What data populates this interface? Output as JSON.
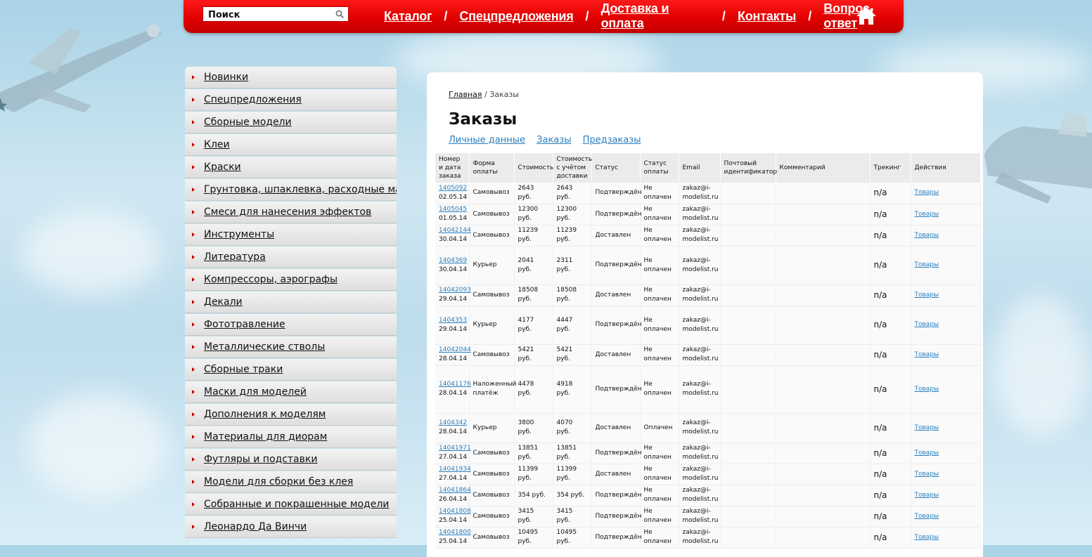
{
  "search": {
    "placeholder": "Поиск"
  },
  "topnav": {
    "items": [
      "Каталог",
      "Спецпредложения",
      "Доставка и оплата",
      "Контакты",
      "Вопрос-ответ"
    ],
    "separator": "/"
  },
  "sidebar": {
    "items": [
      "Новинки",
      "Спецпредложения",
      "Сборные модели",
      "Клеи",
      "Краски",
      "Грунтовка, шпаклевка, расходные материалы",
      "Смеси для нанесения эффектов",
      "Инструменты",
      "Литература",
      "Компрессоры, аэрографы",
      "Декали",
      "Фототравление",
      "Металлические стволы",
      "Сборные траки",
      "Маски для моделей",
      "Дополнения к моделям",
      "Материалы для диорам",
      "Футляры и подставки",
      "Модели для сборки без клея",
      "Собранные и покрашенные модели",
      "Леонардо Да Винчи"
    ]
  },
  "main": {
    "breadcrumb": {
      "home": "Главная",
      "sep": " / ",
      "current": "Заказы"
    },
    "title": "Заказы",
    "tabs": [
      "Личные данные",
      "Заказы",
      "Предзаказы"
    ],
    "table": {
      "headers": [
        "Номер и дата заказа",
        "Форма оплаты",
        "Стоимость",
        "Стоимость с учётом доставки",
        "Статус",
        "Статус оплаты",
        "Email",
        "Почтовый идентификатор",
        "Комментарий",
        "Трекинг",
        "Действия"
      ],
      "rows": [
        {
          "num": "1405092",
          "date": "02.05.14",
          "pay": "Самовывоз",
          "cost": "2643 руб.",
          "total": "2643 руб.",
          "status": "Подтверждён",
          "paid": "Не оплачен",
          "email": "zakaz@i-modelist.ru",
          "post": "",
          "comment": "",
          "track": "n/a",
          "action": "Товары",
          "h": 30
        },
        {
          "num": "1405045",
          "date": "01.05.14",
          "pay": "Самовывоз",
          "cost": "12300 руб.",
          "total": "12300 руб.",
          "status": "Подтверждён",
          "paid": "Не оплачен",
          "email": "zakaz@i-modelist.ru",
          "post": "",
          "comment": "",
          "track": "n/a",
          "action": "Товары",
          "h": 30
        },
        {
          "num": "14042144",
          "date": "30.04.14",
          "pay": "Самовывоз",
          "cost": "11239 руб.",
          "total": "11239 руб.",
          "status": "Доставлен",
          "paid": "Не оплачен",
          "email": "zakaz@i-modelist.ru",
          "post": "",
          "comment": "",
          "track": "n/a",
          "action": "Товары",
          "h": 30
        },
        {
          "num": "1404369",
          "date": "30.04.14",
          "pay": "Курьер",
          "cost": "2041 руб.",
          "total": "2311 руб.",
          "status": "Подтверждён",
          "paid": "Не оплачен",
          "email": "zakaz@i-modelist.ru",
          "post": "",
          "comment": "",
          "track": "n/a",
          "action": "Товары",
          "h": 55
        },
        {
          "num": "14042093",
          "date": "29.04.14",
          "pay": "Самовывоз",
          "cost": "18508 руб.",
          "total": "18508 руб.",
          "status": "Доставлен",
          "paid": "Не оплачен",
          "email": "zakaz@i-modelist.ru",
          "post": "",
          "comment": "",
          "track": "n/a",
          "action": "Товары",
          "h": 30
        },
        {
          "num": "1404353",
          "date": "29.04.14",
          "pay": "Курьер",
          "cost": "4177 руб.",
          "total": "4447 руб.",
          "status": "Подтверждён",
          "paid": "Не оплачен",
          "email": "zakaz@i-modelist.ru",
          "post": "",
          "comment": "",
          "track": "n/a",
          "action": "Товары",
          "h": 55
        },
        {
          "num": "14042044",
          "date": "28.04.14",
          "pay": "Самовывоз",
          "cost": "5421 руб.",
          "total": "5421 руб.",
          "status": "Доставлен",
          "paid": "Не оплачен",
          "email": "zakaz@i-modelist.ru",
          "post": "",
          "comment": "",
          "track": "n/a",
          "action": "Товары",
          "h": 30
        },
        {
          "num": "14041176",
          "date": "28.04.14",
          "pay": "Наложенный платёж",
          "cost": "4478 руб.",
          "total": "4918 руб.",
          "status": "Подтверждён",
          "paid": "Не оплачен",
          "email": "zakaz@i-modelist.ru",
          "post": "",
          "comment": "",
          "track": "n/a",
          "action": "Товары",
          "h": 68
        },
        {
          "num": "1404342",
          "date": "28.04.14",
          "pay": "Курьер",
          "cost": "3800 руб.",
          "total": "4070 руб.",
          "status": "Доставлен",
          "paid": "Оплачен",
          "email": "zakaz@i-modelist.ru",
          "post": "",
          "comment": "",
          "track": "n/a",
          "action": "Товары",
          "h": 42
        },
        {
          "num": "14041971",
          "date": "27.04.14",
          "pay": "Самовывоз",
          "cost": "13851 руб.",
          "total": "13851 руб.",
          "status": "Подтверждён",
          "paid": "Не оплачен",
          "email": "zakaz@i-modelist.ru",
          "post": "",
          "comment": "",
          "track": "n/a",
          "action": "Товары",
          "h": 30
        },
        {
          "num": "14041934",
          "date": "27.04.14",
          "pay": "Самовывоз",
          "cost": "11399 руб.",
          "total": "11399 руб.",
          "status": "Доставлен",
          "paid": "Не оплачен",
          "email": "zakaz@i-modelist.ru",
          "post": "",
          "comment": "",
          "track": "n/a",
          "action": "Товары",
          "h": 30
        },
        {
          "num": "14041864",
          "date": "26.04.14",
          "pay": "Самовывоз",
          "cost": "354 руб.",
          "total": "354 руб.",
          "status": "Подтверждён",
          "paid": "Не оплачен",
          "email": "zakaz@i-modelist.ru",
          "post": "",
          "comment": "",
          "track": "n/a",
          "action": "Товары",
          "h": 30
        },
        {
          "num": "14041808",
          "date": "25.04.14",
          "pay": "Самовывоз",
          "cost": "3415 руб.",
          "total": "3415 руб.",
          "status": "Подтверждён",
          "paid": "Не оплачен",
          "email": "zakaz@i-modelist.ru",
          "post": "",
          "comment": "",
          "track": "n/a",
          "action": "Товары",
          "h": 30
        },
        {
          "num": "14041800",
          "date": "25.04.14",
          "pay": "Самовывоз",
          "cost": "10495 руб.",
          "total": "10495 руб.",
          "status": "Подтверждён",
          "paid": "Не оплачен",
          "email": "zakaz@i-modelist.ru",
          "post": "",
          "comment": "",
          "track": "n/a",
          "action": "Товары",
          "h": 30
        }
      ]
    }
  },
  "colors": {
    "header_red": "#e10000",
    "link_blue": "#2a7fbf",
    "sidebar_arrow": "#c00000"
  }
}
